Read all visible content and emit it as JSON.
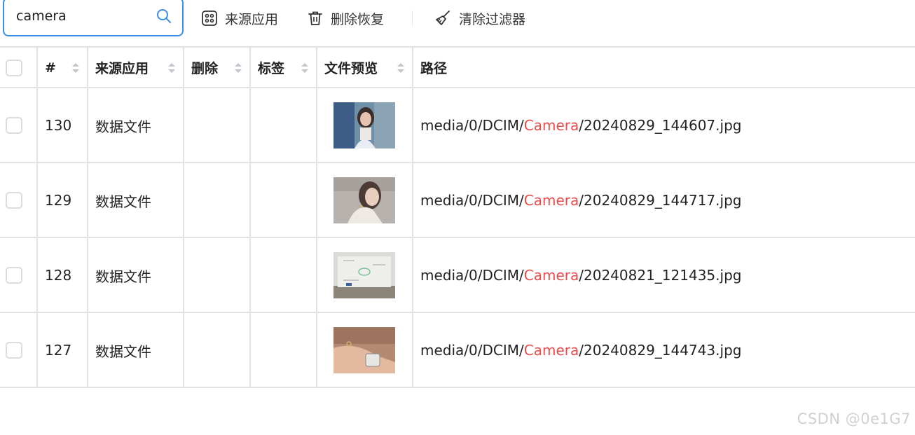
{
  "search": {
    "value": "camera",
    "icon": "search-icon"
  },
  "toolbar": {
    "source_app_label": "来源应用",
    "delete_restore_label": "删除恢复",
    "clear_filters_label": "清除过滤器"
  },
  "table": {
    "columns": [
      "#",
      "来源应用",
      "删除",
      "标签",
      "文件预览",
      "路径"
    ],
    "rows": [
      {
        "id": "130",
        "source_app": "数据文件",
        "deleted": "",
        "tag": "",
        "path_prefix": "media/0/DCIM/",
        "path_match": "Camera",
        "path_suffix": "/20240829_144607.jpg"
      },
      {
        "id": "129",
        "source_app": "数据文件",
        "deleted": "",
        "tag": "",
        "path_prefix": "media/0/DCIM/",
        "path_match": "Camera",
        "path_suffix": "/20240829_144717.jpg"
      },
      {
        "id": "128",
        "source_app": "数据文件",
        "deleted": "",
        "tag": "",
        "path_prefix": "media/0/DCIM/",
        "path_match": "Camera",
        "path_suffix": "/20240821_121435.jpg"
      },
      {
        "id": "127",
        "source_app": "数据文件",
        "deleted": "",
        "tag": "",
        "path_prefix": "media/0/DCIM/",
        "path_match": "Camera",
        "path_suffix": "/20240829_144743.jpg"
      }
    ]
  },
  "colors": {
    "accent": "#3a8ee6",
    "highlight": "#e84c4c",
    "border": "#e2e2e2"
  },
  "watermark": "CSDN @0e1G7"
}
